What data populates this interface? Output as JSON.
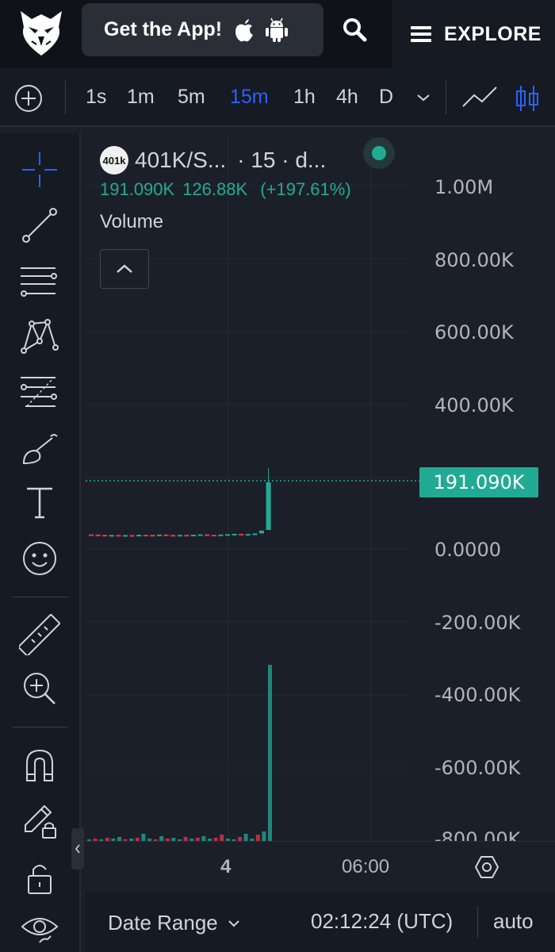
{
  "header": {
    "app_pill_label": "Get the App!",
    "explore_label": "EXPLORE"
  },
  "toolbar": {
    "timeframes": [
      "1s",
      "1m",
      "5m",
      "15m",
      "1h",
      "4h",
      "D"
    ],
    "active_timeframe": "15m"
  },
  "legend": {
    "coin_logo_text": "401k",
    "symbol": "401K/S...",
    "interval_exchange": "· 15 · d...",
    "last_value": "191.090K",
    "change": "126.88K",
    "change_pct": "(+197.61%)",
    "indicator": "Volume"
  },
  "y_axis_labels": [
    "1.00M",
    "800.00K",
    "600.00K",
    "400.00K",
    "0.0000",
    "-200.00K",
    "-400.00K",
    "-600.00K",
    "-800.00K"
  ],
  "last_price_tag": "191.090K",
  "time_axis": {
    "day_label": "4",
    "time_label": "06:00"
  },
  "bottom_bar": {
    "date_range_label": "Date Range",
    "clock": "02:12:24 (UTC)",
    "scale_mode": "auto"
  },
  "colors": {
    "up": "#22ab94",
    "down": "#f23645",
    "active": "#2962ff",
    "background": "#1b1f2a"
  },
  "chart_data": {
    "type": "bar",
    "ylim": [
      -800000,
      1000000
    ],
    "last_value": 191090,
    "price_candles_open": [
      20,
      18,
      15,
      12,
      14,
      10,
      13,
      11,
      16,
      15,
      12,
      18,
      14,
      10,
      15,
      13,
      17,
      20,
      16,
      13,
      18,
      22,
      26,
      20,
      24,
      30,
      60
    ],
    "price_candles_close": [
      18,
      15,
      12,
      14,
      10,
      13,
      11,
      16,
      15,
      12,
      18,
      14,
      10,
      15,
      13,
      17,
      20,
      16,
      13,
      18,
      22,
      26,
      20,
      24,
      30,
      60,
      191090
    ],
    "volume_bars": [
      2,
      3,
      2,
      4,
      3,
      5,
      2,
      3,
      4,
      9,
      3,
      2,
      6,
      3,
      4,
      2,
      5,
      3,
      4,
      6,
      3,
      4,
      8,
      3,
      2,
      5,
      9,
      3,
      8,
      12,
      220
    ]
  }
}
